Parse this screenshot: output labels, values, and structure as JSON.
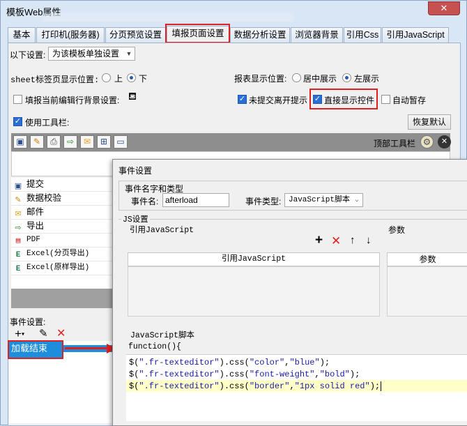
{
  "window": {
    "title": "模板Web属性",
    "close_glyph": "✕"
  },
  "tabs": [
    "基本",
    "打印机(服务器)",
    "分页预览设置",
    "填报页面设置",
    "数据分析设置",
    "浏览器背景",
    "引用Css",
    "引用JavaScript"
  ],
  "settings": {
    "scope_label": "以下设置:",
    "scope_value": "为该模板单独设置",
    "sheet_pos_label": "sheet标签页显示位置:",
    "sheet_pos_top": "上",
    "sheet_pos_bottom": "下",
    "report_pos_label": "报表显示位置:",
    "report_center": "居中展示",
    "report_left": "左展示",
    "fill_bg_label": "填报当前编辑行背景设置:",
    "unsubmitted_label": "未提交离开提示",
    "direct_show_label": "直接显示控件",
    "autosave_label": "自动暂存",
    "use_toolbar_label": "使用工具栏:",
    "restore_default": "恢复默认",
    "top_toolbar_label": "顶部工具栏"
  },
  "toolbar_items": [
    {
      "label": "提交",
      "icon": "save-icon",
      "glyph": "▣",
      "color": "#2a4f8a"
    },
    {
      "label": "数据校验",
      "icon": "edit-icon",
      "glyph": "✎",
      "color": "#c8820a"
    },
    {
      "label": "邮件",
      "icon": "mail-icon",
      "glyph": "✉",
      "color": "#e8a020"
    },
    {
      "label": "导出",
      "icon": "export-icon",
      "glyph": "⇨",
      "color": "#2e8b2e"
    },
    {
      "label": "PDF",
      "icon": "pdf-icon",
      "glyph": "▤",
      "color": "#c62828"
    },
    {
      "label": "Excel(分页导出)",
      "icon": "excel-icon",
      "glyph": "E",
      "color": "#1e7e4a"
    },
    {
      "label": "Excel(原样导出)",
      "icon": "excel-icon",
      "glyph": "E",
      "color": "#1e7e4a"
    }
  ],
  "events": {
    "label": "事件设置:",
    "selected": "加载结束"
  },
  "dialog": {
    "title": "事件设置",
    "name_type_group": "事件名字和类型",
    "name_label": "事件名:",
    "name_value": "afterload",
    "type_label": "事件类型:",
    "type_value": "JavaScript脚本",
    "js_group": "JS设置",
    "ref_js_label": "引用JavaScript",
    "params_label": "参数",
    "ref_js_col": "引用JavaScript",
    "params_col": "参数",
    "script_label": "JavaScript脚本",
    "function_header": "function(){",
    "code_lines": [
      [
        "$(",
        "\".fr-texteditor\"",
        ").css(",
        "\"color\"",
        ",",
        "\"blue\"",
        ");"
      ],
      [
        "$(",
        "\".fr-texteditor\"",
        ").css(",
        "\"font-weight\"",
        ",",
        "\"bold\"",
        ");"
      ],
      [
        "$(",
        "\".fr-texteditor\"",
        ").css(",
        "\"border\"",
        ",",
        "\"1px solid red\"",
        ");"
      ]
    ]
  }
}
